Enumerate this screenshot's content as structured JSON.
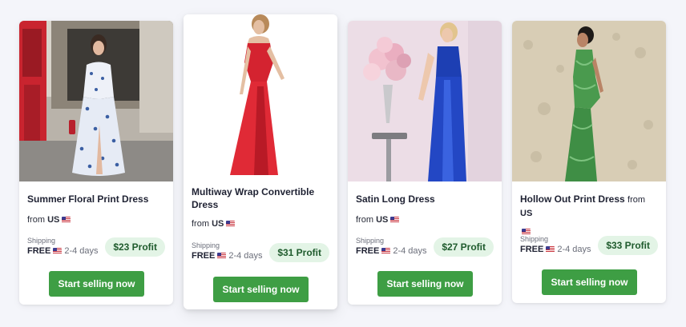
{
  "products": [
    {
      "title": "Summer Floral Print Dress",
      "from_label": "from",
      "country": "US",
      "shipping_label": "Shipping",
      "shipping_price": "FREE",
      "shipping_time": "2-4 days",
      "profit": "$23 Profit",
      "cta": "Start selling now"
    },
    {
      "title": "Multiway Wrap Convertible Dress",
      "from_label": "from",
      "country": "US",
      "shipping_label": "Shipping",
      "shipping_price": "FREE",
      "shipping_time": "2-4 days",
      "profit": "$31 Profit",
      "cta": "Start selling now"
    },
    {
      "title": "Satin Long Dress",
      "from_label": "from",
      "country": "US",
      "shipping_label": "Shipping",
      "shipping_price": "FREE",
      "shipping_time": "2-4 days",
      "profit": "$27 Profit",
      "cta": "Start selling now"
    },
    {
      "title": "Hollow Out Print Dress",
      "from_label": "from",
      "country": "US",
      "shipping_label": "Shipping",
      "shipping_price": "FREE",
      "shipping_time": "2-4 days",
      "profit": "$33 Profit",
      "cta": "Start selling now"
    }
  ],
  "colors": {
    "cta_green": "#3e9e44",
    "profit_bg": "#e3f4e6",
    "profit_text": "#1f5b2d",
    "page_bg": "#f4f5fa"
  }
}
